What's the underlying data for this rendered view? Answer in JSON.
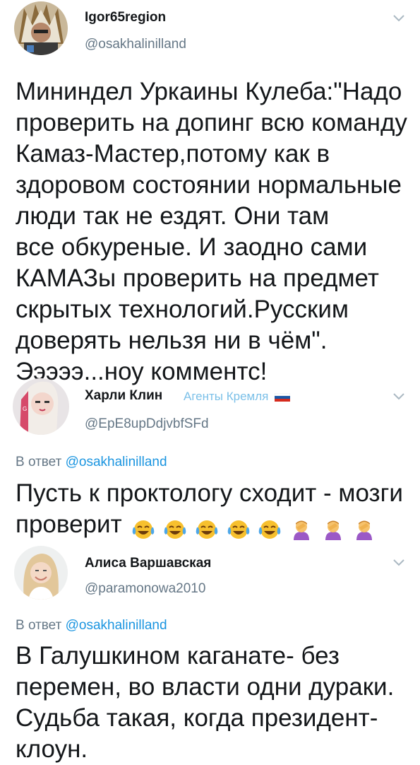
{
  "tweet1": {
    "name": "Igor65region",
    "handle": "@osakhalinilland",
    "lines": [
      "Мининдел Уркаины Кулеба:\"Надо",
      "проверить на допинг всю команду",
      "Камаз-Мастер,потому как в",
      "здоровом состоянии нормальные",
      "люди так не ездят. Они там",
      "все обкуреные. И заодно сами",
      "КАМАЗы проверить на предмет",
      "скрытых технологий.Русским",
      "доверять нельзя ни в чём\".",
      "Эээээ...ноу комментс!"
    ]
  },
  "tweet2": {
    "name": "Харли Клин",
    "badge": "Агенты Кремля",
    "handle": "@EpE8upDdjvbfSFd",
    "reply_prefix": "В ответ ",
    "reply_mention": "@osakhalinilland",
    "lines": [
      "Пусть к проктологу сходит - мозги",
      "проверит"
    ],
    "emojis": [
      "crying-laughing",
      "crying-laughing",
      "crying-laughing",
      "crying-laughing",
      "crying-laughing",
      "facepalm",
      "facepalm",
      "facepalm"
    ]
  },
  "tweet3": {
    "name": "Алиса Варшавская",
    "handle": "@paramonowa2010",
    "reply_prefix": "В ответ ",
    "reply_mention": "@osakhalinilland",
    "lines": [
      "В Галушкином каганате- без",
      "перемен, во власти одни дураки.",
      "Судьба такая, когда президент-",
      "клоун."
    ]
  },
  "colors": {
    "text": "#14171a",
    "secondary": "#657786",
    "mention": "#1b95e0",
    "badge": "#7cc0e8"
  }
}
